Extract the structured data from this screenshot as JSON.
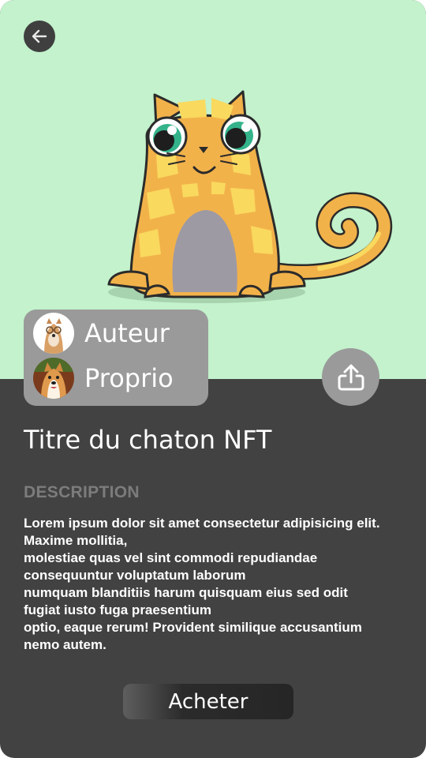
{
  "nav": {
    "back_icon": "arrow-left-icon"
  },
  "people": {
    "author_label": "Auteur",
    "owner_label": "Proprio"
  },
  "share": {
    "icon": "share-upload-icon"
  },
  "nft": {
    "title": "Titre du chaton NFT"
  },
  "description": {
    "heading": "DESCRIPTION",
    "lines": [
      "Lorem ipsum dolor sit amet consectetur adipisicing elit.",
      "Maxime mollitia,",
      "molestiae quas vel sint commodi repudiandae",
      "consequuntur voluptatum laborum",
      "numquam blanditiis harum quisquam eius sed odit",
      "fugiat iusto fuga praesentium",
      "optio, eaque rerum! Provident similique accusantium",
      "nemo autem."
    ]
  },
  "actions": {
    "buy_label": "Acheter"
  },
  "colors": {
    "hero_background": "#c3f2cc",
    "panel_background": "#424242",
    "card_background": "#9a9a9a",
    "cat_fur": "#f2b24a",
    "cat_spots": "#f9d95e",
    "cat_belly": "#9e9aa4"
  }
}
